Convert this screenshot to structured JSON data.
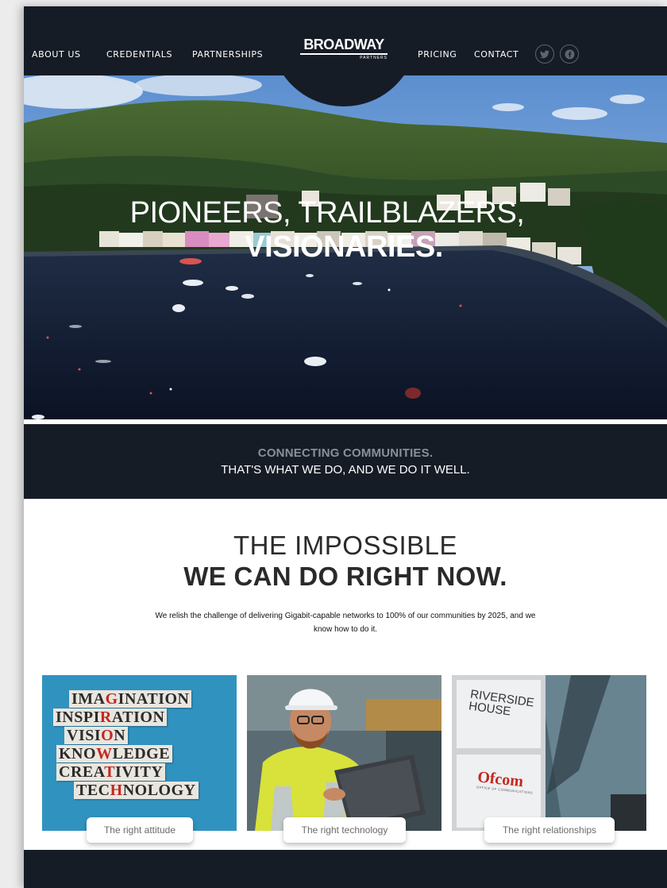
{
  "nav": {
    "about": "ABOUT US",
    "credentials": "CREDENTIALS",
    "partnerships": "PARTNERSHIPS",
    "pricing": "PRICING",
    "contact": "CONTACT"
  },
  "logo": {
    "main": "BROADWAY",
    "sub": "PARTNERS"
  },
  "social": [
    "twitter-icon",
    "facebook-icon"
  ],
  "hero": {
    "line1": "PIONEERS, TRAILBLAZERS,",
    "line2": "VISIONARIES."
  },
  "banner": {
    "line1": "CONNECTING COMMUNITIES.",
    "line2": "THAT'S WHAT WE DO, AND WE DO IT WELL."
  },
  "impossible": {
    "title1": "THE IMPOSSIBLE",
    "title2": "WE CAN DO RIGHT NOW.",
    "text": "We relish the challenge of delivering Gigabit-capable networks to 100% of our communities by 2025, and we know how to do it."
  },
  "cards": [
    {
      "label": "The right attitude",
      "words": [
        {
          "before": "IMA",
          "red": "G",
          "after": "INATION"
        },
        {
          "before": "INSPI",
          "red": "R",
          "after": "ATION"
        },
        {
          "before": "VISI",
          "red": "O",
          "after": "N"
        },
        {
          "before": "KNO",
          "red": "W",
          "after": "LEDGE"
        },
        {
          "before": "CREA",
          "red": "T",
          "after": "IVITY"
        },
        {
          "before": "TEC",
          "red": "H",
          "after": "NOLOGY"
        }
      ]
    },
    {
      "label": "The right technology"
    },
    {
      "label": "The right relationships",
      "sign1": "RIVERSIDE",
      "sign2": "HOUSE",
      "ofcom": "Ofcom",
      "ofcom_sub": "OFFICE OF COMMUNICATIONS"
    }
  ],
  "colors": {
    "navy": "#161c26",
    "grey_text": "#8a8f98",
    "ofcom_red": "#c3281f"
  }
}
